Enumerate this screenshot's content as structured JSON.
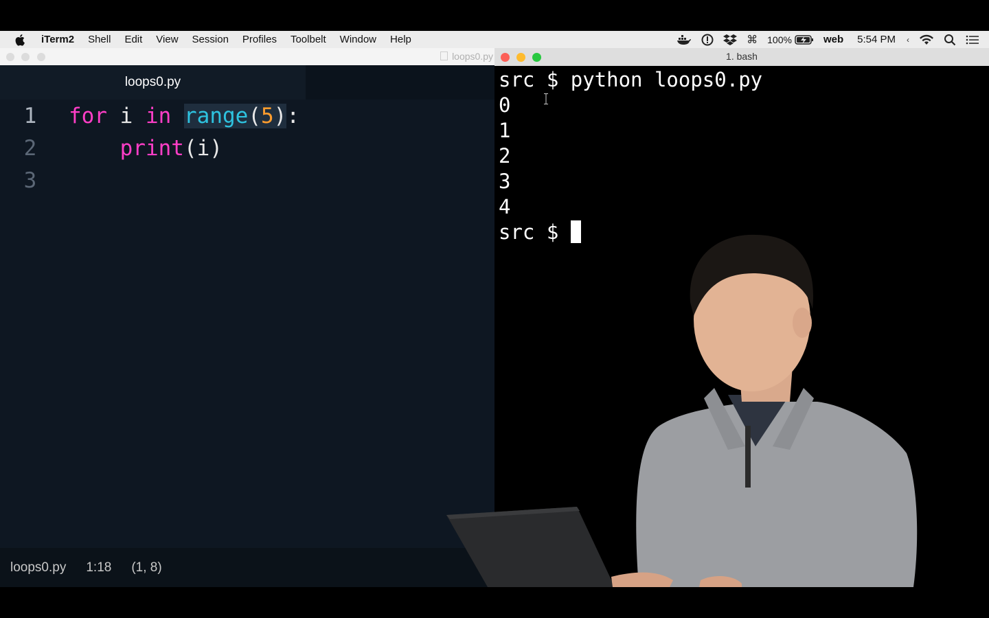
{
  "menubar": {
    "app_name": "iTerm2",
    "items": [
      "Shell",
      "Edit",
      "View",
      "Session",
      "Profiles",
      "Toolbelt",
      "Window",
      "Help"
    ],
    "battery": "100%",
    "network_label": "web",
    "time": "5:54 PM",
    "status_icons": [
      "docker-icon",
      "info-icon",
      "dropbox-icon",
      "command-key-icon",
      "battery-icon",
      "chevron-left-icon",
      "wifi-icon",
      "spotlight-icon",
      "notification-center-icon"
    ]
  },
  "editor": {
    "window_title": "loops0.py",
    "tab_label": "loops0.py",
    "line_numbers": [
      "1",
      "2",
      "3"
    ],
    "line1": {
      "kw_for": "for",
      "var": " i ",
      "kw_in": "in",
      "space": " ",
      "fn": "range",
      "paren_open": "(",
      "num": "5",
      "paren_close": ")",
      "colon": ":"
    },
    "line2": {
      "indent": "    ",
      "fn": "print",
      "rest": "(i)"
    },
    "status": {
      "filename": "loops0.py",
      "position": "1:18",
      "selection": "(1, 8)"
    }
  },
  "terminal": {
    "title": "1. bash",
    "lines": [
      "src $ python loops0.py",
      "0",
      "1",
      "2",
      "3",
      "4"
    ],
    "prompt": "src $ "
  },
  "colors": {
    "keyword": "#ff3ec7",
    "function": "#2ec3e0",
    "number": "#ff9d2e",
    "editor_bg": "#0e1722",
    "terminal_bg": "#000000"
  }
}
